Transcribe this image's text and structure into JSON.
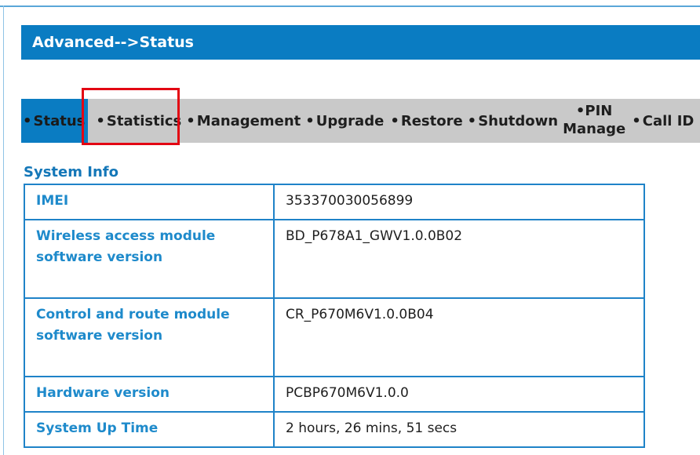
{
  "page": {
    "title": "Advanced-->Status"
  },
  "nav": {
    "items": [
      {
        "bullet": "•",
        "label": "Status",
        "active": true
      },
      {
        "bullet": "•",
        "label": "Statistics",
        "active": false
      },
      {
        "bullet": "•",
        "label": "Management",
        "active": false
      },
      {
        "bullet": "•",
        "label": "Upgrade",
        "active": false
      },
      {
        "bullet": "•",
        "label": "Restore",
        "active": false
      },
      {
        "bullet": "•",
        "label": "Shutdown",
        "active": false
      },
      {
        "bullet": "•",
        "label_line1": "PIN",
        "label_line2": "Manage",
        "active": false
      },
      {
        "bullet": "•",
        "label": "Call ID",
        "active": false
      }
    ]
  },
  "system_info": {
    "title": "System Info",
    "rows": [
      {
        "label": "IMEI",
        "value": "353370030056899"
      },
      {
        "label": "Wireless access module software version",
        "value": "BD_P678A1_GWV1.0.0B02"
      },
      {
        "label": "Control and route module software version",
        "value": "CR_P670M6V1.0.0B04"
      },
      {
        "label": "Hardware version",
        "value": "PCBP670M6V1.0.0"
      },
      {
        "label": "System Up Time",
        "value": "2 hours, 26 mins, 51 secs"
      }
    ]
  },
  "colors": {
    "header_bg": "#0a7cc2",
    "nav_bg": "#c9c9c9",
    "label_text": "#1e8acb",
    "table_border": "#1f83c8",
    "highlight": "#e30613"
  }
}
